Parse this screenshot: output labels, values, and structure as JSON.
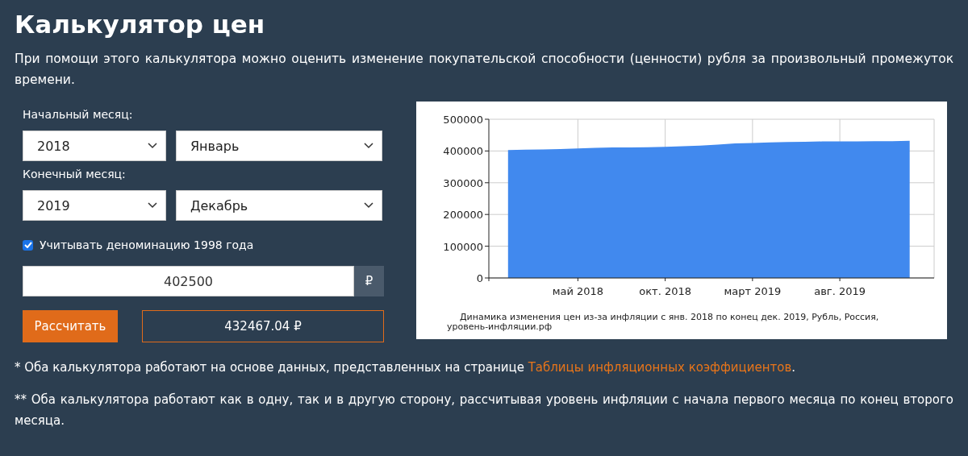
{
  "title": "Калькулятор цен",
  "intro": "При помощи этого калькулятора можно оценить изменение покупательской способности (ценности) рубля за произвольный промежуток времени.",
  "start": {
    "label": "Начальный месяц:",
    "year": "2018",
    "month": "Январь"
  },
  "end": {
    "label": "Конечный месяц:",
    "year": "2019",
    "month": "Декабрь"
  },
  "denomination": {
    "label": "Учитывать деноминацию 1998 года",
    "checked": true
  },
  "amount": {
    "value": "402500",
    "currency": "₽"
  },
  "calculate_button": "Рассчитать",
  "result": "432467.04 ₽",
  "chart": {
    "source": "уровень-инфляции.рф",
    "chart_data": {
      "type": "area",
      "title": "Динамика изменения цен из-за инфляции с янв. 2018 по конец дек. 2019, Рубль, Россия,",
      "categories": [
        null,
        null,
        null,
        null,
        "май 2018",
        null,
        null,
        null,
        null,
        "окт. 2018",
        null,
        null,
        null,
        null,
        "март 2019",
        null,
        null,
        null,
        null,
        "авг. 2019",
        null,
        null,
        null,
        null
      ],
      "series": [
        {
          "color": "#4189ee",
          "values": [
            403000,
            404000,
            405000,
            406000,
            408000,
            410000,
            411000,
            411000,
            412000,
            413000,
            415000,
            417000,
            420000,
            424000,
            425000,
            427000,
            428000,
            429000,
            430000,
            430000,
            430000,
            431000,
            431000,
            432000
          ]
        }
      ],
      "ylim": [
        0,
        500000
      ],
      "grid": true,
      "yticks": [
        0,
        100000,
        200000,
        300000,
        400000,
        500000
      ]
    }
  },
  "notes": [
    {
      "text": "* Оба калькулятора работают на основе данных, представленных на странице ",
      "link": "Таблицы инфляционных коэффициентов",
      "tail": "."
    },
    {
      "text": "** Оба калькулятора работают как в одну, так и в другую сторону, рассчитывая уровень инфляции с начала первого месяца по конец второго месяца."
    }
  ]
}
